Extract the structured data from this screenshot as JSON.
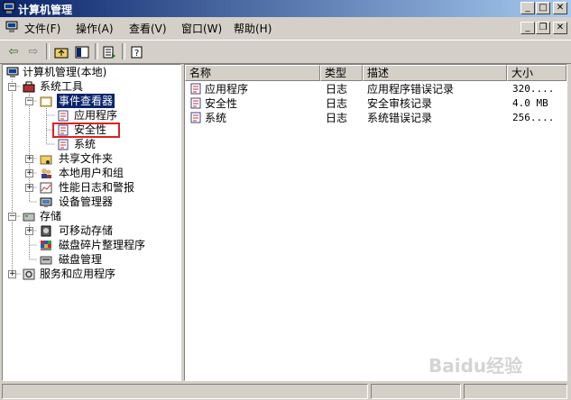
{
  "window": {
    "title": "计算机管理"
  },
  "menu": {
    "items": [
      "文件(F)",
      "操作(A)",
      "查看(V)",
      "窗口(W)",
      "帮助(H)"
    ]
  },
  "tree": {
    "root": "计算机管理(本地)",
    "system_tools": "系统工具",
    "event_viewer": "事件查看器",
    "app_log": "应用程序",
    "security_log": "安全性",
    "system_log": "系统",
    "shared_folders": "共享文件夹",
    "local_users": "本地用户和组",
    "perf_logs": "性能日志和警报",
    "device_manager": "设备管理器",
    "storage": "存储",
    "removable": "可移动存储",
    "defrag": "磁盘碎片整理程序",
    "disk_mgmt": "磁盘管理",
    "services_apps": "服务和应用程序"
  },
  "table": {
    "columns": [
      "名称",
      "类型",
      "描述",
      "大小"
    ],
    "rows": [
      {
        "name": "应用程序",
        "type": "日志",
        "desc": "应用程序错误记录",
        "size": "320...."
      },
      {
        "name": "安全性",
        "type": "日志",
        "desc": "安全审核记录",
        "size": "4.0 MB"
      },
      {
        "name": "系统",
        "type": "日志",
        "desc": "系统错误记录",
        "size": "256...."
      }
    ]
  },
  "watermark": "Baidu经验",
  "highlight_color": "#e02020"
}
